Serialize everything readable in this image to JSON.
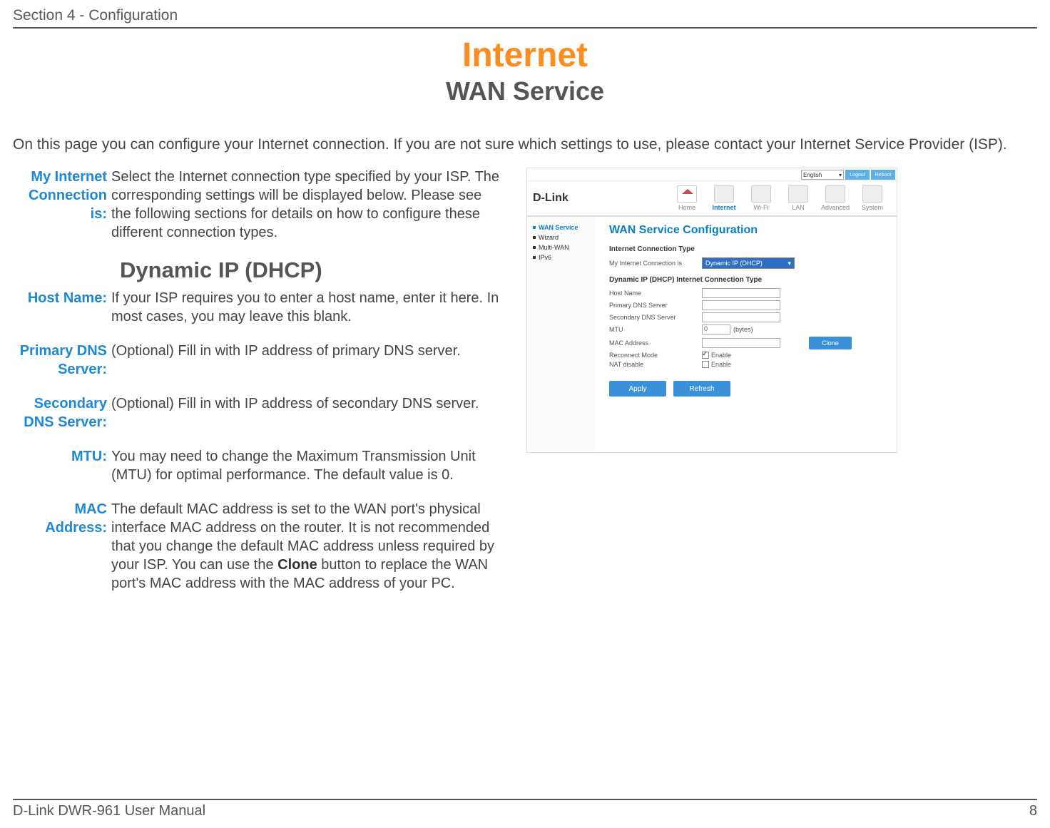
{
  "header": {
    "section": "Section 4 - Configuration"
  },
  "title": "Internet",
  "subtitle": "WAN Service",
  "intro": "On this page you can configure your Internet connection. If you are not sure which settings to use, please contact your Internet Service Provider (ISP).",
  "defs": {
    "my_internet_label": "My Internet Connection is:",
    "my_internet_text": "Select the Internet connection type specified by your ISP. The corresponding settings will be displayed below. Please see the following sections for details on how to configure these different connection types.",
    "dhcp_heading": "Dynamic IP (DHCP)",
    "host_label": "Host Name:",
    "host_text": "If your ISP requires you to enter a host name, enter it here. In most cases, you may leave this blank.",
    "pdns_label": "Primary DNS Server:",
    "pdns_text": "(Optional) Fill in with IP address of primary DNS server.",
    "sdns_label": "Secondary DNS Server:",
    "sdns_text": "(Optional) Fill in with IP address of secondary DNS server.",
    "mtu_label": "MTU:",
    "mtu_text": "You may need to change the Maximum Transmission Unit (MTU) for optimal performance. The default value is 0.",
    "mac_label": "MAC Address:",
    "mac_text_pre": "The default MAC address is set to the WAN port's physical interface MAC address on the router. It is not recommended that you change the default MAC address unless required by your ISP. You can use the ",
    "mac_bold": "Clone",
    "mac_text_post": " button to replace the WAN port's MAC address with the MAC address of your PC."
  },
  "screenshot": {
    "lang": "English",
    "logout": "Logout",
    "reboot": "Reboot",
    "logo": "D-Link",
    "nav": {
      "home": "Home",
      "internet": "Internet",
      "wifi": "Wi-Fi",
      "lan": "LAN",
      "advanced": "Advanced",
      "system": "System"
    },
    "sidebar": {
      "wan": "WAN Service",
      "wizard": "Wizard",
      "multiwan": "Multi-WAN",
      "ipv6": "IPv6"
    },
    "panel_title": "WAN Service Configuration",
    "sect1": "Internet Connection Type",
    "my_conn_label": "My Internet Connection is",
    "my_conn_value": "Dynamic IP (DHCP)",
    "sect2": "Dynamic IP (DHCP) Internet Connection Type",
    "host_name_label": "Host Name",
    "pdns_label": "Primary DNS Server",
    "sdns_label": "Secondary DNS Server",
    "mtu_label": "MTU",
    "mtu_value": "0",
    "mtu_unit": "(bytes)",
    "mac_label": "MAC Address",
    "clone": "Clone",
    "reconnect_label": "Reconnect Mode",
    "enable_text": "Enable",
    "nat_label": "NAT disable",
    "apply": "Apply",
    "refresh": "Refresh"
  },
  "footer": {
    "left": "D-Link DWR-961 User Manual",
    "right": "8"
  }
}
